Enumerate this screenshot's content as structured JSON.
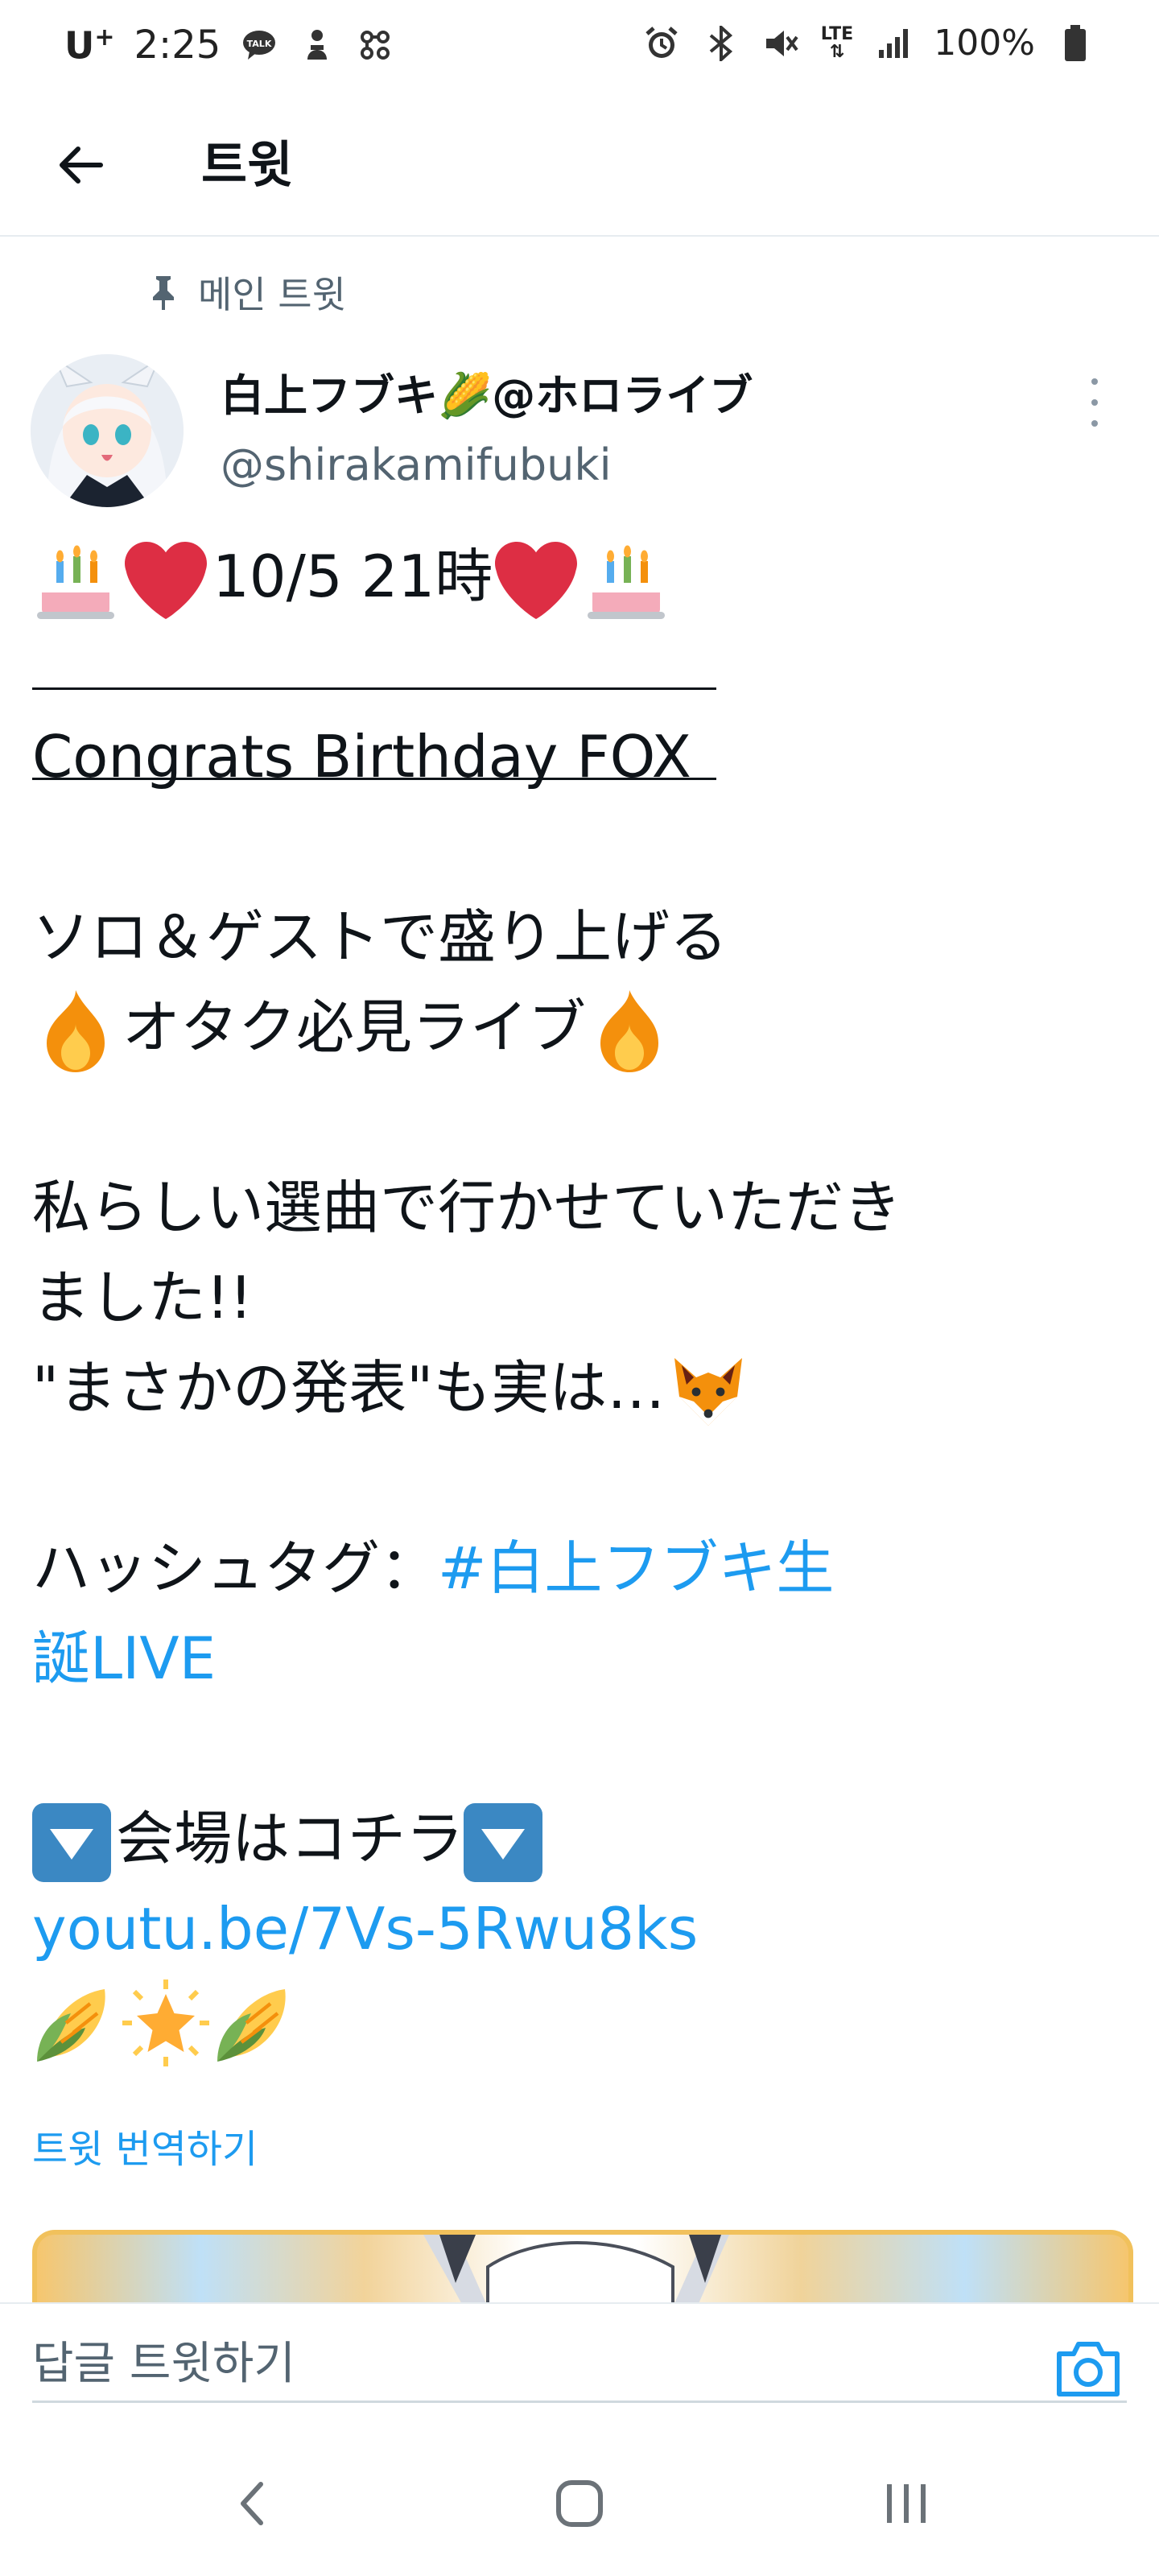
{
  "status_bar": {
    "carrier": "U",
    "carrier_sup": "+",
    "time": "2:25",
    "battery": "100%",
    "network": "LTE"
  },
  "app_bar": {
    "title": "트윗"
  },
  "tweet": {
    "pinned_label": "메인 트윗",
    "author_name": "白上フブキ🌽@ホロライブ",
    "author_handle": "@shirakamifubuki",
    "line1_text": "10/5 21時",
    "headline": "Congrats Birthday FOX",
    "para1_line1": "ソロ＆ゲストで盛り上げる",
    "para1_line2": "オタク必見ライブ",
    "para2_line1": "私らしい選曲で行かせていただき",
    "para2_line2": "ました!!",
    "para2_line3": "\"まさかの発表\"も実は…",
    "hashtag_prefix": "ハッシュタグ：",
    "hashtag_part1": "#白上フブキ生",
    "hashtag_part2": "誕LIVE",
    "venue_text": "会場はコチラ",
    "link": "youtu.be/7Vs-5Rwu8ks",
    "translate_label": "트윗 번역하기"
  },
  "reply": {
    "placeholder": "답글 트윗하기"
  },
  "icons": {
    "back": "arrow-left-icon",
    "pin": "pin-icon",
    "more": "more-vertical-icon",
    "camera": "camera-icon",
    "nav_back": "chevron-left-icon",
    "nav_home": "home-icon",
    "nav_recents": "recents-icon"
  },
  "colors": {
    "link": "#1d9bf0",
    "secondary_text": "#536471",
    "heart": "#dd2e44",
    "box": "#3b88c3"
  }
}
